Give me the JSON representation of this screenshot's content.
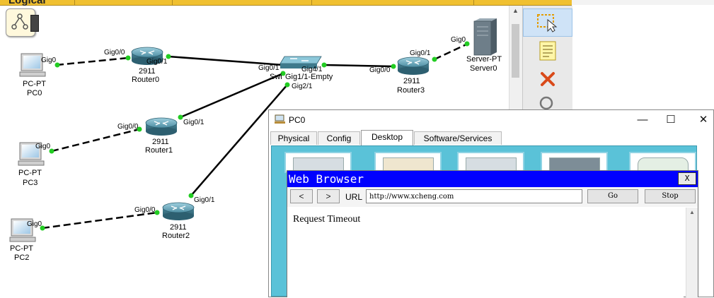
{
  "workspace": {
    "label": "Logical"
  },
  "devices": {
    "pc0": {
      "type": "PC-PT",
      "name": "PC0",
      "port": "Gig0"
    },
    "pc3": {
      "type": "PC-PT",
      "name": "PC3",
      "port": "Gig0"
    },
    "pc2": {
      "type": "PC-PT",
      "name": "PC2",
      "port": "Gig0"
    },
    "router0": {
      "model": "2911",
      "name": "Router0",
      "port_a": "Gig0/0",
      "port_b": "Gig0/1"
    },
    "router1": {
      "model": "2911",
      "name": "Router1",
      "port_a": "Gig0/0",
      "port_b": "Gig0/1"
    },
    "router2": {
      "model": "2911",
      "name": "Router2",
      "port_a": "Gig0/0",
      "port_b": "Gig0/1"
    },
    "router3": {
      "model": "2911",
      "name": "Router3",
      "port_a": "Gig0/0",
      "port_b": "Gig0/1"
    },
    "switch": {
      "name_partial": "Swi",
      "port_gig01": "Gig0/1",
      "port_gig41": "Gig4/1",
      "port_gig11": "Gig1/1-Empty",
      "port_gig21": "Gig2/1"
    },
    "server0": {
      "type": "Server-PT",
      "name": "Server0",
      "port": "Gig0"
    }
  },
  "colors": {
    "link_dot": "#22cc22",
    "browser_title": "#0000ff",
    "desktop_bg": "#5ac2d8"
  },
  "tools": [
    "select-icon",
    "note-icon",
    "delete-icon",
    "inspect-icon"
  ],
  "pc_window": {
    "title": "PC0",
    "controls": {
      "minimize": "—",
      "maximize": "☐",
      "close": "✕"
    },
    "tabs": [
      "Physical",
      "Config",
      "Desktop",
      "Software/Services"
    ],
    "active_tab": "Desktop",
    "browser": {
      "title": "Web Browser",
      "close_label": "X",
      "back_label": "<",
      "forward_label": ">",
      "url_label": "URL",
      "url_value": "http://www.xcheng.com",
      "go_label": "Go",
      "stop_label": "Stop",
      "message": "Request Timeout"
    }
  }
}
